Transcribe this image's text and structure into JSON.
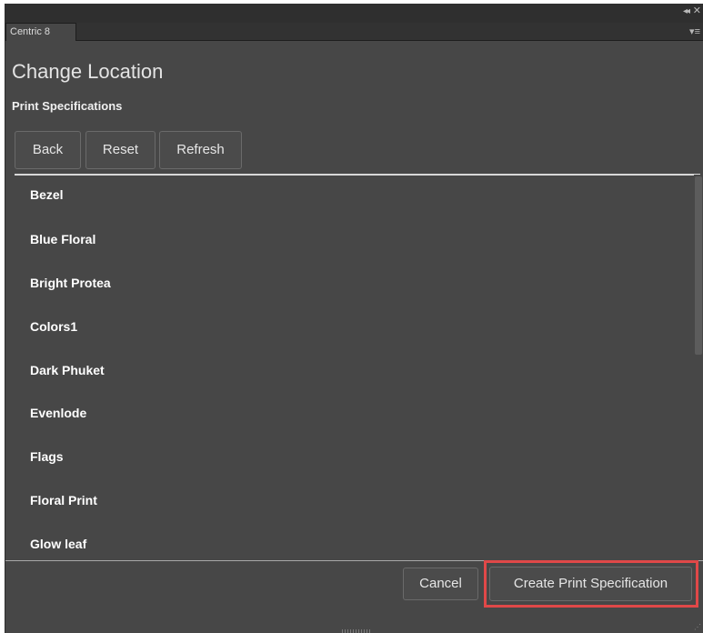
{
  "panel": {
    "tab_label": "Centric 8",
    "collapse_icon": "double-chevron-left-icon",
    "close_icon": "close-icon",
    "menu_icon": "panel-menu-icon"
  },
  "header": {
    "title": "Change Location",
    "subtitle": "Print Specifications"
  },
  "toolbar": {
    "back_label": "Back",
    "reset_label": "Reset",
    "refresh_label": "Refresh"
  },
  "list": {
    "items": [
      {
        "label": "Bezel"
      },
      {
        "label": "Blue Floral"
      },
      {
        "label": "Bright Protea"
      },
      {
        "label": "Colors1"
      },
      {
        "label": "Dark Phuket"
      },
      {
        "label": "Evenlode"
      },
      {
        "label": "Flags"
      },
      {
        "label": "Floral Print"
      },
      {
        "label": "Glow leaf"
      }
    ]
  },
  "footer": {
    "cancel_label": "Cancel",
    "create_label": "Create Print Specification",
    "highlight_color": "#e04848"
  }
}
